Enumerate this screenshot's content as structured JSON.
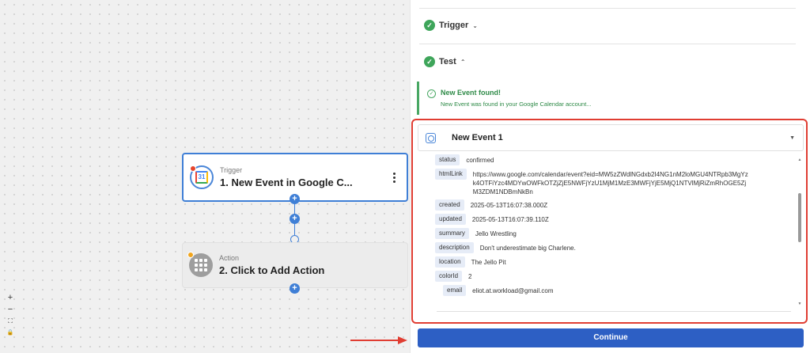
{
  "canvas": {
    "trigger_node": {
      "kind": "Trigger",
      "title": "1. New Event in Google C..."
    },
    "action_node": {
      "kind": "Action",
      "title": "2. Click to Add Action"
    },
    "connector_plus": "+",
    "zoom": {
      "in": "+",
      "out": "−",
      "fit": "⛶",
      "lock": "🔒"
    }
  },
  "panel": {
    "trigger_section": {
      "label": "Trigger",
      "chevron": "⌄"
    },
    "test_section": {
      "label": "Test",
      "chevron": "⌃"
    },
    "found": {
      "title": "New Event found!",
      "subtitle": "New Event was found in your Google Calendar account..."
    },
    "event": {
      "title": "New Event 1",
      "fields": [
        {
          "key": "status",
          "value": "confirmed"
        },
        {
          "key": "htmlLink",
          "value": "https://www.google.com/calendar/event?eid=MW5zZWdlNGdxb2I4NG1nM2loMGU4NTRpb3MgYzk4OTFiYzc4MDYwOWFkOTZjZjE5NWFjYzU1MjM1MzE3MWFjYjE5MjQ1NTVlMjRiZmRhOGE5ZjM3ZDM1NDBmNkBn"
        },
        {
          "key": "created",
          "value": "2025-05-13T16:07:38.000Z"
        },
        {
          "key": "updated",
          "value": "2025-05-13T16:07:39.110Z"
        },
        {
          "key": "summary",
          "value": "Jello Wrestling"
        },
        {
          "key": "description",
          "value": "Don't underestimate big Charlene."
        },
        {
          "key": "location",
          "value": "The Jello Pit"
        },
        {
          "key": "colorId",
          "value": "2"
        },
        {
          "key": "email",
          "value": "eliot.at.workload@gmail.com"
        }
      ]
    },
    "continue_label": "Continue"
  },
  "colors": {
    "accent": "#2d5fc4",
    "success": "#3ea55a",
    "highlight_border": "#e03d32"
  }
}
